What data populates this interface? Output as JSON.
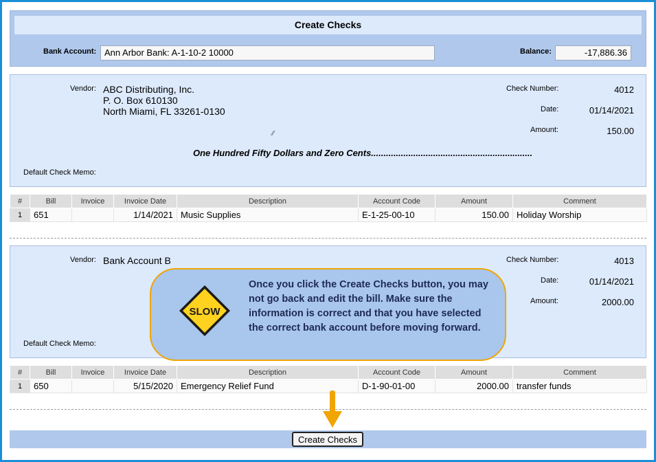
{
  "header": {
    "title": "Create Checks",
    "bank_account_label": "Bank Account:",
    "bank_account_value": "Ann Arbor Bank: A-1-10-2 10000",
    "balance_label": "Balance:",
    "balance_value": "-17,886.36"
  },
  "labels": {
    "vendor": "Vendor:",
    "check_number": "Check Number:",
    "date": "Date:",
    "amount": "Amount:",
    "default_memo": "Default Check Memo:"
  },
  "columns": [
    "#",
    "Bill",
    "Invoice",
    "Invoice Date",
    "Description",
    "Account Code",
    "Amount",
    "Comment"
  ],
  "checks": [
    {
      "vendor_lines": [
        "ABC Distributing, Inc.",
        "P. O. Box 610130",
        "North Miami, FL 33261-0130"
      ],
      "check_number": "4012",
      "date": "01/14/2021",
      "amount": "150.00",
      "amount_words": "One Hundred Fifty Dollars and Zero Cents.................................................................",
      "rows": [
        {
          "num": "1",
          "bill": "651",
          "invoice": "",
          "invoice_date": "1/14/2021",
          "description": "Music Supplies",
          "account_code": "E-1-25-00-10",
          "amount": "150.00",
          "comment": "Holiday Worship"
        }
      ]
    },
    {
      "vendor_lines": [
        "Bank Account B"
      ],
      "check_number": "4013",
      "date": "01/14/2021",
      "amount": "2000.00",
      "rows": [
        {
          "num": "1",
          "bill": "650",
          "invoice": "",
          "invoice_date": "5/15/2020",
          "description": "Emergency Relief Fund",
          "account_code": "D-1-90-01-00",
          "amount": "2000.00",
          "comment": "transfer funds"
        }
      ]
    }
  ],
  "callout": {
    "sign_text": "SLOW",
    "message": "Once you click the Create Checks button, you may not go back and edit the bill. Make sure the information is correct and that you have selected the correct bank account before moving forward."
  },
  "footer": {
    "create_button_label": "Create Checks"
  },
  "colors": {
    "frame": "#1a8fd6",
    "header_bg": "#b0c8ec",
    "panel_bg": "#ddeafc",
    "callout_border": "#f0a500",
    "sign_yellow": "#ffd21f"
  },
  "icons": [
    "slow-sign-icon",
    "down-arrow-icon",
    "resize-grip-icon"
  ]
}
